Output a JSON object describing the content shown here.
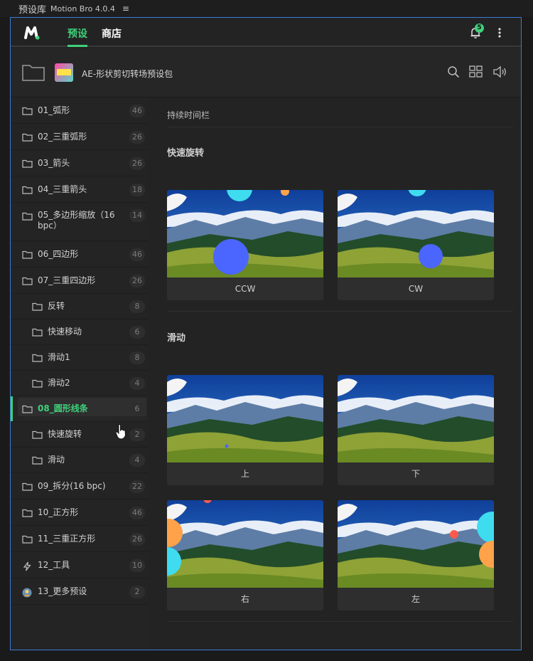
{
  "window": {
    "title": "预设库",
    "app_version": "Motion Bro 4.0.4",
    "menu_glyph": "≡"
  },
  "nav": {
    "tabs": [
      "预设",
      "商店"
    ],
    "notifications_count": "5"
  },
  "pack": {
    "name": "AE-形状剪切转场预设包"
  },
  "sidebar": {
    "items": [
      {
        "label": "01_弧形",
        "count": "46",
        "icon": "folder-icon"
      },
      {
        "label": "02_三重弧形",
        "count": "26",
        "icon": "folder-icon"
      },
      {
        "label": "03_箭头",
        "count": "26",
        "icon": "folder-icon"
      },
      {
        "label": "04_三重箭头",
        "count": "18",
        "icon": "folder-icon"
      },
      {
        "label": "05_多边形缩放（16 bpc）",
        "count": "14",
        "icon": "folder-icon"
      },
      {
        "label": "06_四边形",
        "count": "46",
        "icon": "folder-icon"
      },
      {
        "label": "07_三重四边形",
        "count": "26",
        "icon": "folder-icon"
      },
      {
        "label": "反转",
        "count": "8",
        "icon": "folder-icon"
      },
      {
        "label": "快速移动",
        "count": "6",
        "icon": "folder-icon"
      },
      {
        "label": "滑动1",
        "count": "8",
        "icon": "folder-icon"
      },
      {
        "label": "滑动2",
        "count": "4",
        "icon": "folder-icon"
      },
      {
        "label": "08_圆形线条",
        "count": "6",
        "icon": "folder-icon"
      },
      {
        "label": "快速旋转",
        "count": "2",
        "icon": "folder-icon"
      },
      {
        "label": "滑动",
        "count": "4",
        "icon": "folder-icon"
      },
      {
        "label": "09_拆分(16 bpc)",
        "count": "22",
        "icon": "folder-icon"
      },
      {
        "label": "10_正方形",
        "count": "46",
        "icon": "folder-icon"
      },
      {
        "label": "11_三重正方形",
        "count": "26",
        "icon": "folder-icon"
      },
      {
        "label": "12_工具",
        "count": "10",
        "icon": "lightning-icon"
      },
      {
        "label": "13_更多预设",
        "count": "2",
        "icon": "avatar-icon"
      }
    ]
  },
  "main": {
    "breadcrumb": "持续时间栏",
    "sections": [
      {
        "title": "快速旋转",
        "cards": [
          "CCW",
          "CW"
        ]
      },
      {
        "title": "滑动",
        "cards": [
          "上",
          "下",
          "右",
          "左"
        ]
      }
    ]
  },
  "colors": {
    "accent": "#3fd07a",
    "circle_blue": "#4a66ff",
    "circle_cyan": "#3fdcf0",
    "circle_orange": "#ffa24a",
    "circle_red": "#ff5a4a"
  }
}
